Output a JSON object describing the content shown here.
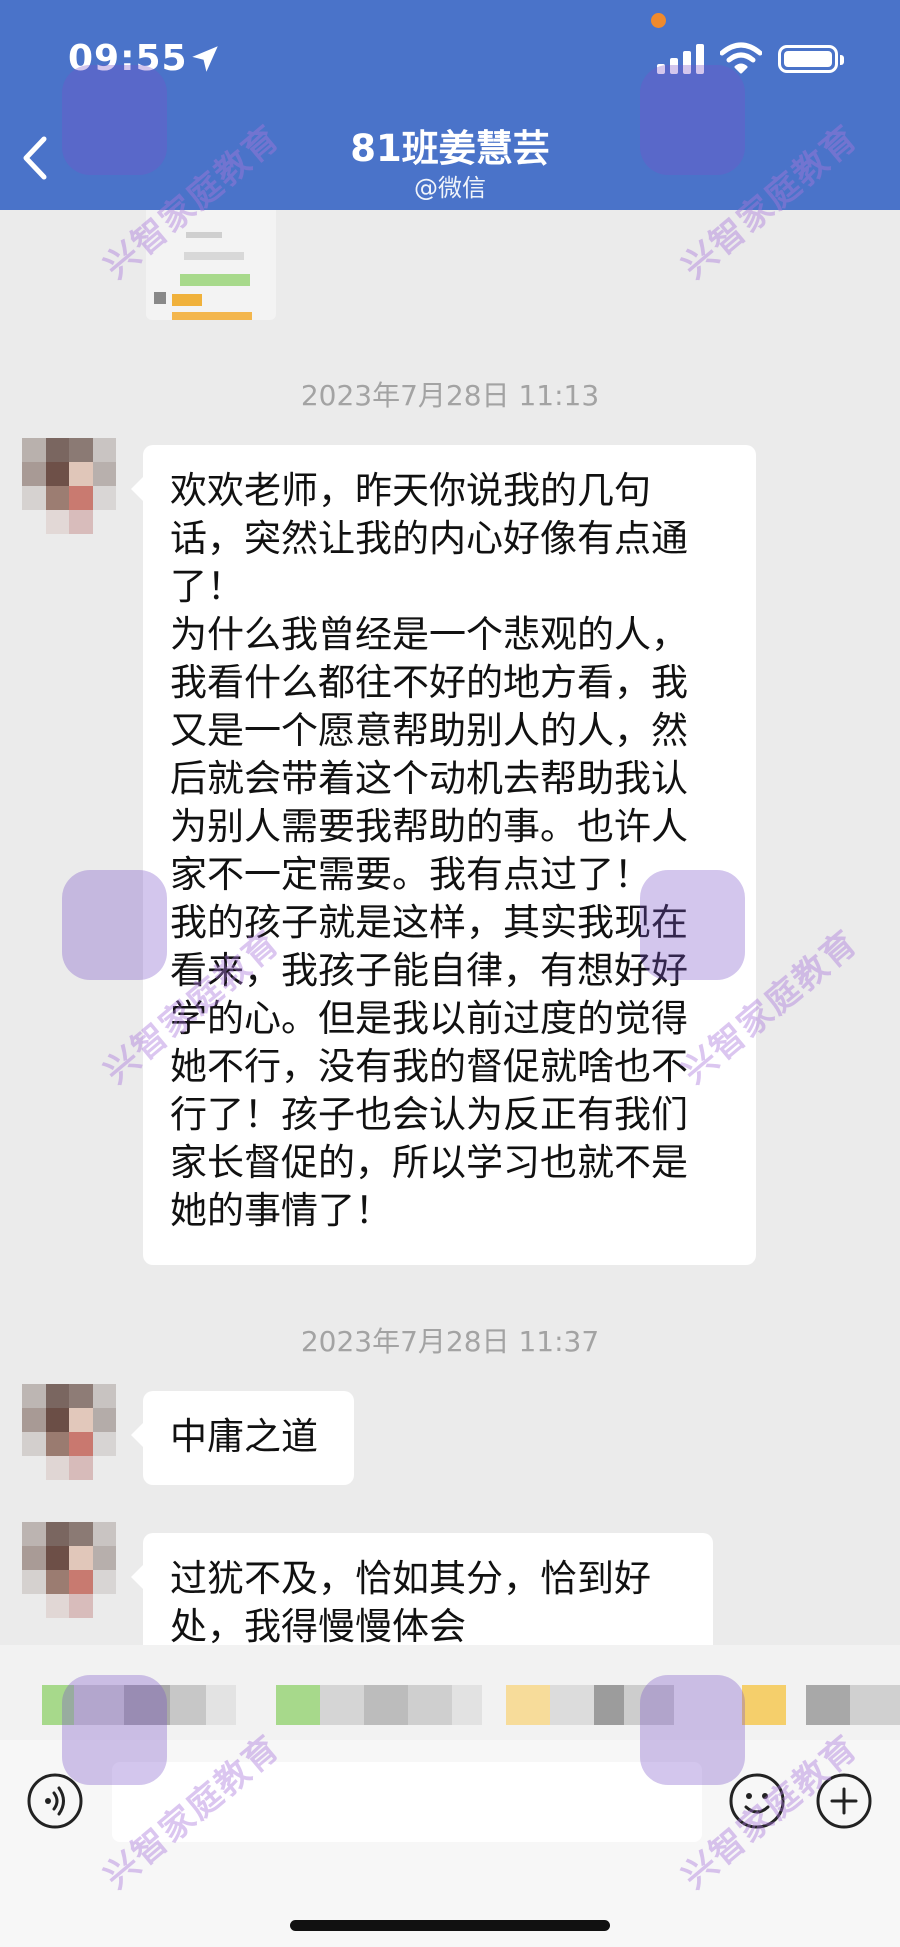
{
  "status_bar": {
    "time": "09:55"
  },
  "header": {
    "title": "81班姜慧芸",
    "subtitle": "@微信"
  },
  "timestamps": [
    "2023年7月28日 11:13",
    "2023年7月28日 11:37"
  ],
  "messages": [
    {
      "text": "欢欢老师，昨天你说我的几句\n话，突然让我的内心好像有点通\n了！\n为什么我曾经是一个悲观的人，\n我看什么都往不好的地方看，我\n又是一个愿意帮助别人的人，然\n后就会带着这个动机去帮助我认\n为别人需要我帮助的事。也许人\n家不一定需要。我有点过了！\n我的孩子就是这样，其实我现在\n看来，我孩子能自律，有想好好\n学的心。但是我以前过度的觉得\n她不行，没有我的督促就啥也不\n行了！孩子也会认为反正有我们\n家长督促的，所以学习也就不是\n她的事情了！"
    },
    {
      "text": "中庸之道"
    },
    {
      "text": "过犹不及，恰如其分，恰到好\n处，我得慢慢体会"
    }
  ],
  "watermark": {
    "text": "兴智家庭教育"
  },
  "colors": {
    "header_bg": "#4a73c9",
    "chat_bg": "#ebebeb",
    "bubble_bg": "#ffffff",
    "timestamp": "#a3a3a3"
  },
  "icons": [
    "location-arrow-icon",
    "cellular-signal-icon",
    "wifi-icon",
    "battery-icon",
    "back-chevron-icon",
    "voice-input-icon",
    "emoji-icon",
    "plus-icon"
  ]
}
